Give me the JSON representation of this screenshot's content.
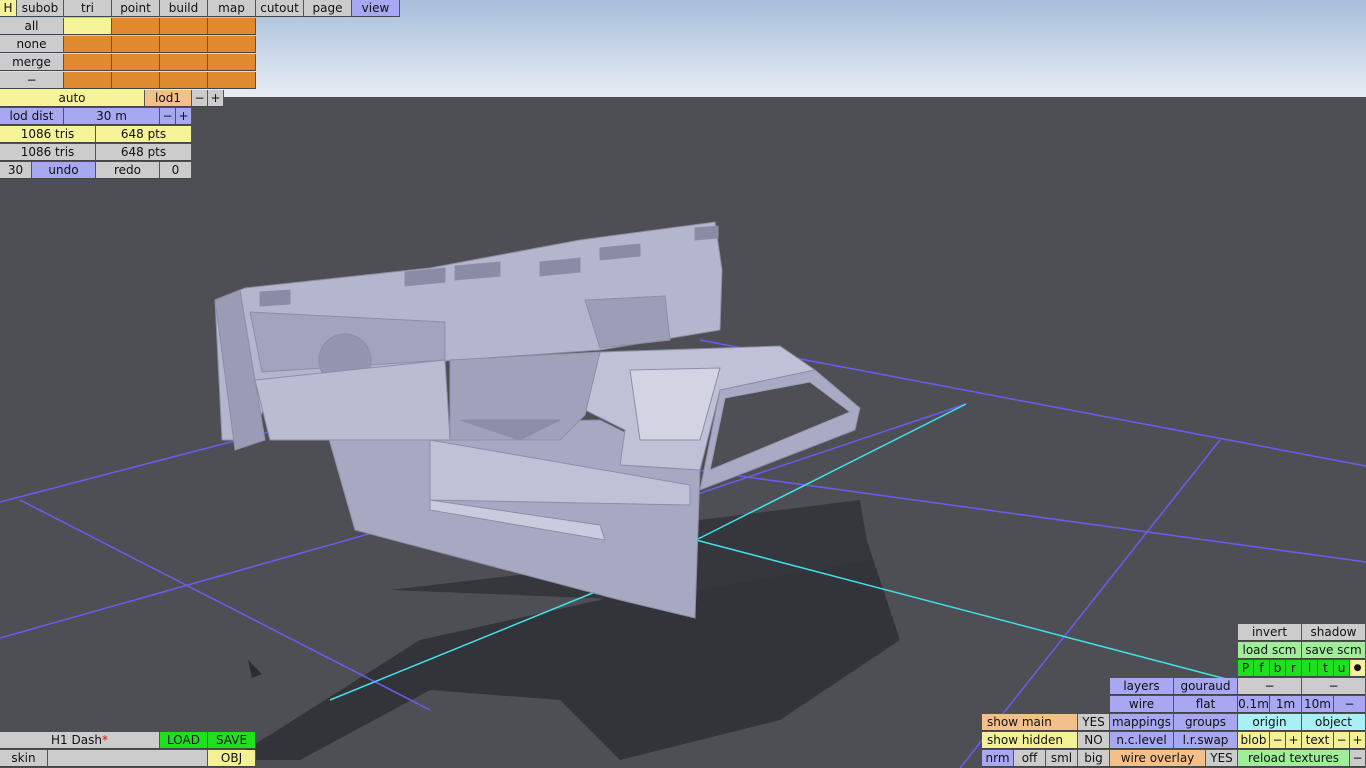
{
  "colors": {
    "sky_top": "#a8c0dc",
    "sky_bottom": "#e6ecf2",
    "floor": "#4e4f55",
    "grid_blue": "#6a5cf0",
    "grid_cyan": "#40e0e8",
    "model": "#b4b6ce",
    "shadow": "#33343a"
  },
  "top_menu": {
    "home": "H",
    "tabs": [
      "subob",
      "tri",
      "point",
      "build",
      "map",
      "cutout",
      "page",
      "view"
    ],
    "active_tab": "view"
  },
  "select": {
    "all": "all",
    "none": "none",
    "merge": "merge",
    "minus": "−"
  },
  "lod": {
    "mode": "auto",
    "level": "lod1",
    "minus": "−",
    "plus": "+",
    "dist_label": "lod dist",
    "dist_value": "30 m"
  },
  "stats": {
    "row1_tris": "1086 tris",
    "row1_pts": "648 pts",
    "row2_tris": "1086 tris",
    "row2_pts": "648 pts"
  },
  "history": {
    "undo_count": "30",
    "undo": "undo",
    "redo": "redo",
    "redo_count": "0"
  },
  "file": {
    "name": "H1 Dash",
    "modified_mark": "*",
    "load": "LOAD",
    "save": "SAVE",
    "skin": "skin",
    "obj": "OBJ"
  },
  "right_panel": {
    "invert": "invert",
    "shadow": "shadow",
    "load_scm": "load scm",
    "save_scm": "save scm",
    "view_letters": [
      "P",
      "f",
      "b",
      "r",
      "l",
      "t",
      "u"
    ],
    "dot": "●",
    "layers": "layers",
    "gouraud": "gouraud",
    "minus": "−",
    "wire": "wire",
    "flat": "flat",
    "grid_01": "0.1m",
    "grid_1": "1m",
    "grid_10": "10m",
    "show_main": "show main",
    "show_main_val": "YES",
    "mappings": "mappings",
    "groups": "groups",
    "origin": "origin",
    "object": "object",
    "show_hidden": "show hidden",
    "show_hidden_val": "NO",
    "nc_level": "n.c.level",
    "lr_swap": "l.r.swap",
    "blob": "blob",
    "text": "text",
    "plus": "+",
    "nrm": "nrm",
    "off": "off",
    "sml": "sml",
    "big": "big",
    "wire_overlay": "wire overlay",
    "wire_overlay_val": "YES",
    "reload_textures": "reload textures"
  }
}
